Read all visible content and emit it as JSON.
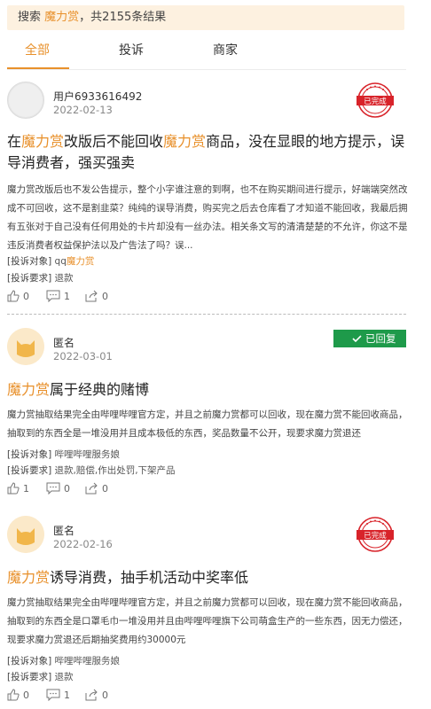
{
  "search": {
    "prefix": "搜索",
    "keyword": "魔力赏",
    "suffix": "，共2155条结果"
  },
  "tabs": [
    {
      "label": "全部"
    },
    {
      "label": "投诉"
    },
    {
      "label": "商家"
    }
  ],
  "labels": {
    "object": "[投诉对象]",
    "demand": "[投诉要求]"
  },
  "colors": {
    "accent": "#e8902b",
    "stamp_red": "#d8232a",
    "replied_green": "#1e9a4a"
  },
  "posts": [
    {
      "user": "用户6933616492",
      "date": "2022-02-13",
      "status": "已完成",
      "title": {
        "p1": "在",
        "k1": "魔力赏",
        "p2": "改版后不能回收",
        "k2": "魔力赏",
        "p3": "商品，没在显眼的地方提示，误导消费者，强买强卖"
      },
      "body": "魔力赏改版后也不发公告提示，整个小字谁注意的到啊，也不在购买期间进行提示，好端端突然改成不可回收，这不是割韭菜？纯纯的误导消费，购买完之后去仓库看了才知道不能回收，我最后拥有五张对于自己没有任何用处的卡片却没有一丝办法。相关条文写的清清楚楚的不允许，你这不是违反消费者权益保护法以及广告法了吗？误...",
      "object_plain": "qq",
      "object_kw": "魔力赏",
      "demand": "退款",
      "likes": "0",
      "comments": "1",
      "shares": "0"
    },
    {
      "user": "匿名",
      "date": "2022-03-01",
      "status": "已回复",
      "title": {
        "k1": "魔力赏",
        "p1": "属于经典的赌博"
      },
      "body": "魔力赏抽取结果完全由哔哩哔哩官方定，并且之前魔力赏都可以回收，现在魔力赏不能回收商品，抽取到的东西全是一堆没用并且成本极低的东西，奖品数量不公开，现要求魔力赏退还",
      "object": "哔哩哔哩服务娘",
      "demand": "退款,赔偿,作出处罚,下架产品",
      "likes": "1",
      "comments": "0",
      "shares": "0"
    },
    {
      "user": "匿名",
      "date": "2022-02-16",
      "status": "已完成",
      "title": {
        "k1": "魔力赏",
        "p1": "诱导消费，抽手机活动中奖率低"
      },
      "body": "魔力赏抽取结果完全由哔哩哔哩官方定，并且之前魔力赏都可以回收，现在魔力赏不能回收商品，抽取到的东西全是口罩毛巾一堆没用并且由哔哩哔哩旗下公司萌盒生产的一些东西，因无力偿还，现要求魔力赏退还后期抽奖费用约30000元",
      "object": "哔哩哔哩服务娘",
      "demand": "退款",
      "likes": "0",
      "comments": "1",
      "shares": "0"
    }
  ]
}
